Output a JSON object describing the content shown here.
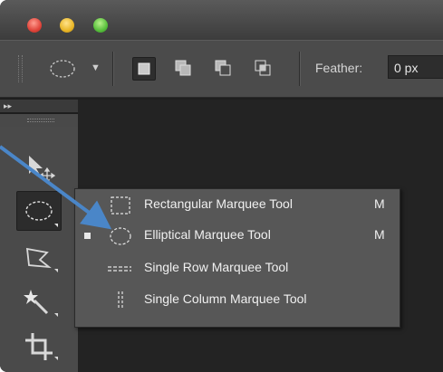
{
  "window": {
    "controls": [
      "close",
      "minimize",
      "maximize"
    ]
  },
  "options_bar": {
    "tool_preset_icon": "ellipse-marquee-icon",
    "selection_modes": [
      "new-selection",
      "add-to-selection",
      "subtract-from-selection",
      "intersect-with-selection"
    ],
    "active_mode": "new-selection",
    "feather_label": "Feather:",
    "feather_value": "0 px"
  },
  "tools_panel": {
    "collapse_glyph": "▸▸",
    "tools": [
      {
        "name": "move-tool",
        "icon": "move-icon",
        "active": false
      },
      {
        "name": "elliptical-marquee-tool",
        "icon": "ellipse-marquee-icon",
        "active": true
      },
      {
        "name": "lasso-tool",
        "icon": "polygonal-lasso-icon",
        "active": false
      },
      {
        "name": "magic-wand-tool",
        "icon": "magic-wand-icon",
        "active": false
      },
      {
        "name": "crop-tool",
        "icon": "crop-icon",
        "active": false
      }
    ]
  },
  "flyout_menu": {
    "items": [
      {
        "label": "Rectangular Marquee Tool",
        "shortcut": "M",
        "selected": false,
        "icon": "rectangular-marquee-icon"
      },
      {
        "label": "Elliptical Marquee Tool",
        "shortcut": "M",
        "selected": true,
        "icon": "elliptical-marquee-icon"
      },
      {
        "label": "Single Row Marquee Tool",
        "shortcut": "",
        "selected": false,
        "icon": "single-row-marquee-icon"
      },
      {
        "label": "Single Column Marquee Tool",
        "shortcut": "",
        "selected": false,
        "icon": "single-column-marquee-icon"
      }
    ]
  },
  "colors": {
    "callout_arrow": "#4a86c8",
    "panel_bg": "#4a4a4a",
    "menu_bg": "#575757"
  }
}
